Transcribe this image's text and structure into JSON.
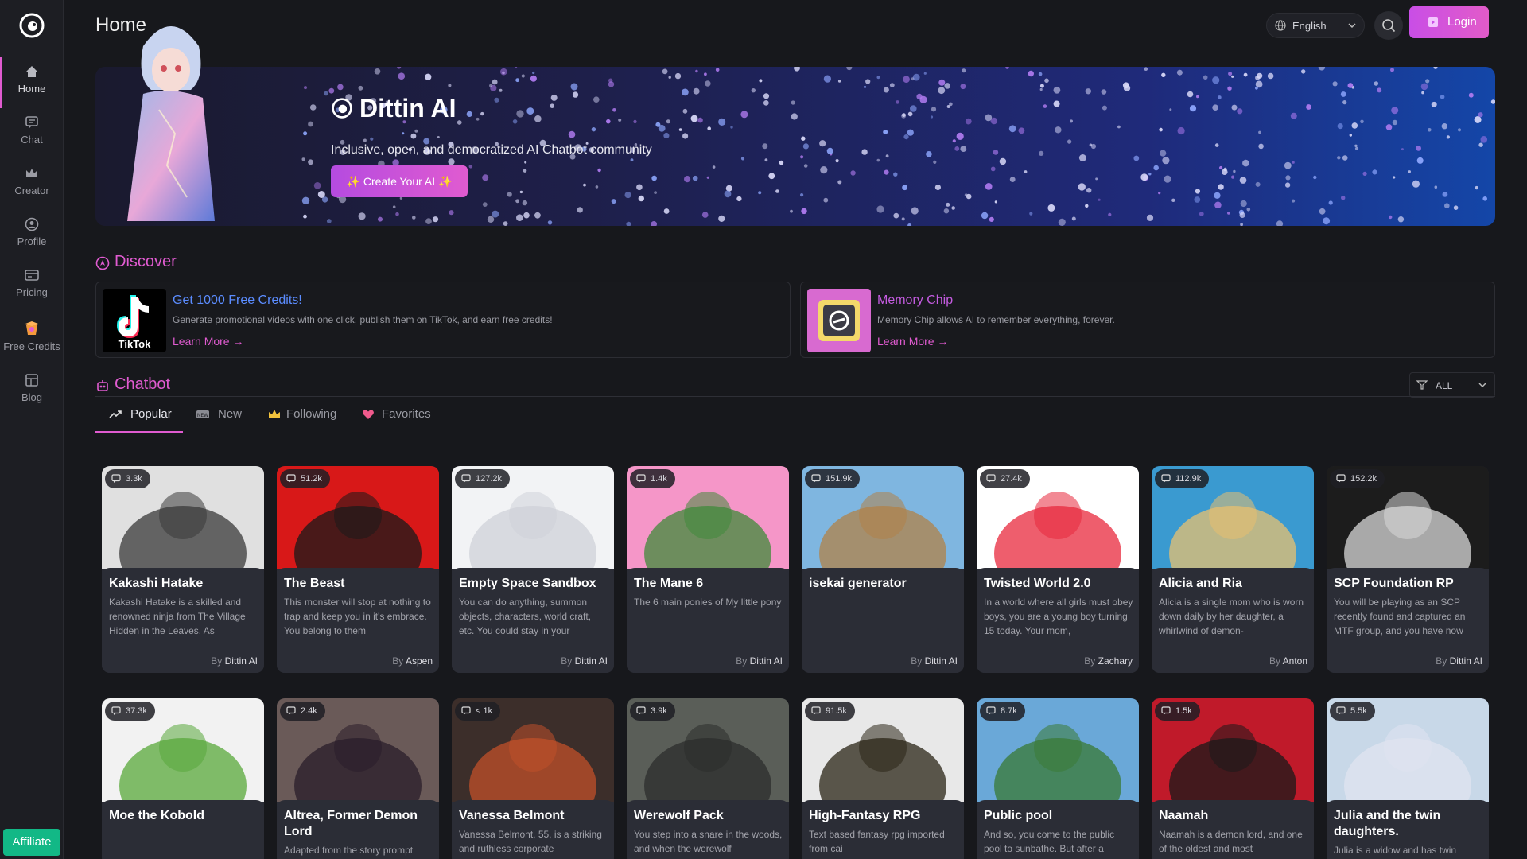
{
  "header": {
    "title": "Home",
    "language": "English",
    "login_label": "Login"
  },
  "sidebar": {
    "items": [
      {
        "label": "Home",
        "icon": "home-icon"
      },
      {
        "label": "Chat",
        "icon": "chat-icon"
      },
      {
        "label": "Creator",
        "icon": "crown-icon"
      },
      {
        "label": "Profile",
        "icon": "profile-icon"
      },
      {
        "label": "Pricing",
        "icon": "pricing-icon"
      },
      {
        "label": "Free Credits",
        "icon": "gift-icon"
      },
      {
        "label": "Blog",
        "icon": "blog-icon"
      }
    ],
    "affiliate_label": "Affiliate"
  },
  "banner": {
    "brand": "Dittin AI",
    "tagline": "Inclusive, open, and democratized AI Chatbot community",
    "cta": "✨ Create Your AI ✨"
  },
  "discover": {
    "title": "Discover",
    "promos": [
      {
        "title": "Get 1000 Free Credits!",
        "desc": "Generate promotional videos with one click, publish them on TikTok, and earn free credits!",
        "link": "Learn More",
        "title_color": "#5b8cff",
        "thumb_label": "TikTok"
      },
      {
        "title": "Memory Chip",
        "desc": "Memory Chip allows AI to remember everything, forever.",
        "link": "Learn More",
        "title_color": "#c45be0"
      }
    ]
  },
  "chatbot": {
    "title": "Chatbot",
    "filter_label": "ALL",
    "tabs": [
      {
        "label": "Popular",
        "icon": "trending-icon",
        "active": true
      },
      {
        "label": "New",
        "icon": "new-badge-icon",
        "active": false
      },
      {
        "label": "Following",
        "icon": "crown-icon",
        "active": false
      },
      {
        "label": "Favorites",
        "icon": "heart-icon",
        "active": false
      }
    ],
    "by_prefix": "By",
    "cards": [
      {
        "title": "Kakashi Hatake",
        "count": "3.3k",
        "desc": "Kakashi Hatake is a skilled and renowned ninja from The Village Hidden in the Leaves. As",
        "author": "Dittin AI"
      },
      {
        "title": "The Beast",
        "count": "51.2k",
        "desc": "This monster will stop at nothing to trap and keep you in it's embrace. You belong to them",
        "author": "Aspen"
      },
      {
        "title": "Empty Space Sandbox",
        "count": "127.2k",
        "desc": "You can do anything, summon objects, characters, world craft, etc. You could stay in your",
        "author": "Dittin AI"
      },
      {
        "title": "The Mane 6",
        "count": "1.4k",
        "desc": "The 6 main ponies of My little pony",
        "author": "Dittin AI"
      },
      {
        "title": "isekai generator",
        "count": "151.9k",
        "desc": "",
        "author": "Dittin AI"
      },
      {
        "title": "Twisted World 2.0",
        "count": "27.4k",
        "desc": "In a world where all girls must obey boys, you are a young boy turning 15 today. Your mom,",
        "author": "Zachary"
      },
      {
        "title": "Alicia and Ria",
        "count": "112.9k",
        "desc": "Alicia is a single mom who is worn down daily by her daughter, a whirlwind of demon-",
        "author": "Anton"
      },
      {
        "title": "SCP Foundation RP",
        "count": "152.2k",
        "desc": "You will be playing as an SCP recently found and captured an MTF group, and you have now",
        "author": "Dittin AI"
      },
      {
        "title": "Moe the Kobold",
        "count": "37.3k",
        "desc": "",
        "author": ""
      },
      {
        "title": "Altrea, Former Demon Lord",
        "count": "2.4k",
        "desc": "Adapted from the story prompt",
        "author": ""
      },
      {
        "title": "Vanessa Belmont",
        "count": "< 1k",
        "desc": "Vanessa Belmont, 55, is a striking and ruthless corporate",
        "author": ""
      },
      {
        "title": "Werewolf Pack",
        "count": "3.9k",
        "desc": "You step into a snare in the woods, and when the werewolf",
        "author": ""
      },
      {
        "title": "High-Fantasy RPG",
        "count": "91.5k",
        "desc": "Text based fantasy rpg imported from cai",
        "author": ""
      },
      {
        "title": "Public pool",
        "count": "8.7k",
        "desc": "And so, you come to the public pool to sunbathe. But after a",
        "author": ""
      },
      {
        "title": "Naamah",
        "count": "1.5k",
        "desc": "Naamah is a demon lord, and one of the oldest and most",
        "author": ""
      },
      {
        "title": "Julia and the twin daughters.",
        "count": "5.5k",
        "desc": "Julia is a widow and has twin",
        "author": ""
      }
    ]
  },
  "colors": {
    "accent": "#e05bd0",
    "affiliate": "#12b886",
    "background": "#17181c"
  }
}
